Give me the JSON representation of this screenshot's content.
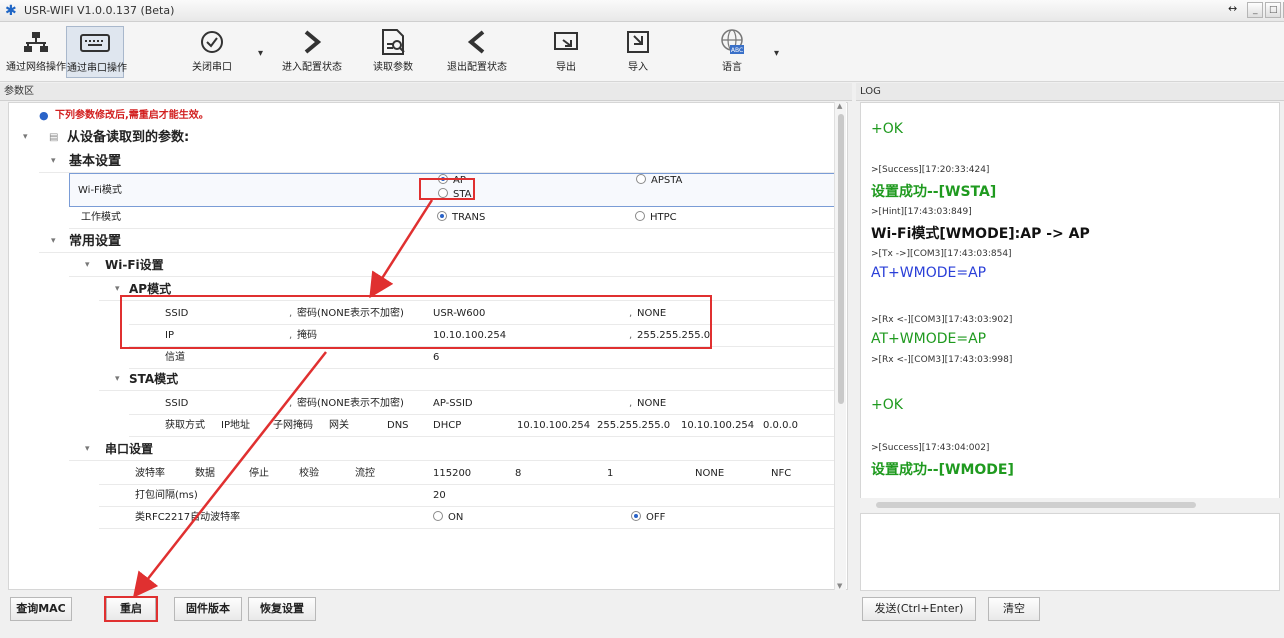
{
  "window": {
    "title": "USR-WIFI V1.0.0.137 (Beta)",
    "resize_arrows": "↔"
  },
  "toolbar": [
    {
      "label": "通过网络操作",
      "icon": "network-icon"
    },
    {
      "label": "通过串口操作",
      "icon": "serial-keyboard-icon"
    },
    {
      "label": "关闭串口",
      "icon": "check-circle-icon"
    },
    {
      "label": "进入配置状态",
      "icon": "chevron-right-icon"
    },
    {
      "label": "读取参数",
      "icon": "read-params-icon"
    },
    {
      "label": "退出配置状态",
      "icon": "chevron-left-icon"
    },
    {
      "label": "导出",
      "icon": "export-icon"
    },
    {
      "label": "导入",
      "icon": "import-icon"
    },
    {
      "label": "语言",
      "icon": "globe-icon",
      "badge": "ABC"
    }
  ],
  "params_panel": {
    "header": "参数区",
    "notice": "下列参数修改后,需重启才能生效。",
    "root_group": "从设备读取到的参数:",
    "basic": {
      "title": "基本设置",
      "wifi_mode_label": "Wi-Fi模式",
      "wifi_mode_options": [
        "AP",
        "APSTA",
        "STA"
      ],
      "work_mode_label": "工作模式",
      "work_mode_options": [
        "TRANS",
        "HTPC"
      ]
    },
    "common": {
      "title": "常用设置",
      "wifi_title": "Wi-Fi设置",
      "ap": {
        "title": "AP模式",
        "ssid_label": "SSID",
        "pwd_label": "密码(NONE表示不加密)",
        "ssid": "USR-W600",
        "pwd": "NONE",
        "ip_label": "IP",
        "mask_label": "掩码",
        "ip": "10.10.100.254",
        "mask": "255.255.255.0",
        "channel_label": "信道",
        "channel": "6"
      },
      "sta": {
        "title": "STA模式",
        "ssid_label": "SSID",
        "pwd_label": "密码(NONE表示不加密)",
        "ssid": "AP-SSID",
        "pwd": "NONE",
        "labels": [
          "获取方式",
          "IP地址",
          "子网掩码",
          "网关",
          "DNS"
        ],
        "values": [
          "DHCP",
          "10.10.100.254",
          "255.255.255.0",
          "10.10.100.254",
          "0.0.0.0"
        ]
      },
      "uart": {
        "title": "串口设置",
        "labels": [
          "波特率",
          "数据",
          "停止",
          "校验",
          "流控"
        ],
        "values": [
          "115200",
          "8",
          "1",
          "NONE",
          "NFC"
        ],
        "pack_label": "打包间隔(ms)",
        "pack_value": "20",
        "rfc_label": "类RFC2217自动波特率",
        "rfc_options": [
          "ON",
          "OFF"
        ]
      }
    }
  },
  "buttons": {
    "query_mac": "查询MAC",
    "restart": "重启",
    "firmware": "固件版本",
    "restore": "恢复设置",
    "send": "发送(Ctrl+Enter)",
    "clear": "清空"
  },
  "log": {
    "header": "LOG",
    "lines": [
      "+OK",
      ">[Success][17:20:33:424]",
      "设置成功--[WSTA]",
      ">[Hint][17:43:03:849]",
      "Wi-Fi模式[WMODE]:AP -> AP",
      ">[Tx ->][COM3][17:43:03:854]",
      "AT+WMODE=AP",
      ">[Rx <-][COM3][17:43:03:902]",
      "AT+WMODE=AP",
      ">[Rx <-][COM3][17:43:03:998]",
      "+OK",
      ">[Success][17:43:04:002]",
      "设置成功--[WMODE]"
    ]
  },
  "colors": {
    "annotation": "#e03030",
    "log_green": "#1f9a1f",
    "log_blue": "#2a3fd8",
    "notice_red": "#d22020",
    "info_blue": "#2a63c8"
  }
}
